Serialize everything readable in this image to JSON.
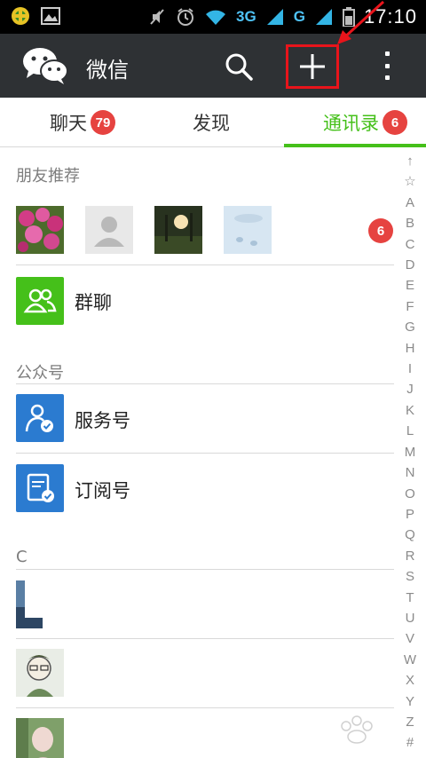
{
  "status_bar": {
    "network_1": "3G",
    "network_2": "G",
    "time": "17:10"
  },
  "action_bar": {
    "title": "微信"
  },
  "tabs": [
    {
      "label": "聊天",
      "badge": "79",
      "active": false
    },
    {
      "label": "发现",
      "badge": "",
      "active": false
    },
    {
      "label": "通讯录",
      "badge": "6",
      "active": true
    }
  ],
  "recommend": {
    "title": "朋友推荐",
    "badge": "6"
  },
  "group_chat": {
    "label": "群聊"
  },
  "official": {
    "title": "公众号",
    "items": [
      {
        "label": "服务号"
      },
      {
        "label": "订阅号"
      }
    ]
  },
  "section_c": {
    "title": "C"
  },
  "alphabet_index": [
    "↑",
    "☆",
    "A",
    "B",
    "C",
    "D",
    "E",
    "F",
    "G",
    "H",
    "I",
    "J",
    "K",
    "L",
    "M",
    "N",
    "O",
    "P",
    "Q",
    "R",
    "S",
    "T",
    "U",
    "V",
    "W",
    "X",
    "Y",
    "Z",
    "#"
  ],
  "colors": {
    "accent_green": "#45c01a",
    "badge_red": "#e64340",
    "action_bar": "#2e3134",
    "highlight_box": "#e8141b",
    "service_blue": "#2b7bd0"
  }
}
